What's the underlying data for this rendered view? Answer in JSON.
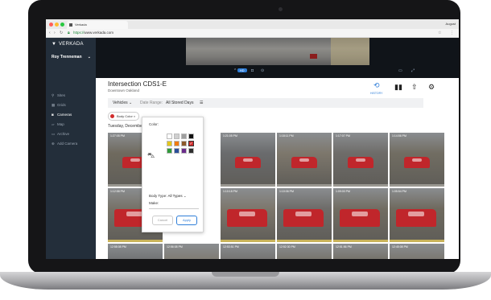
{
  "browser": {
    "tab_title": "Verkada",
    "profile": "August",
    "url_protocol": "https://",
    "url_rest": "www.verkada.com",
    "back_icon": "back-arrow-icon",
    "forward_icon": "forward-arrow-icon",
    "reload_icon": "reload-icon",
    "lock_icon": "lock-icon",
    "star_icon": "star-icon",
    "menu_icon": "more-vertical-icon"
  },
  "sidebar": {
    "logo": "VERKADA",
    "user": "Roy Trenneman",
    "items": [
      {
        "label": "Sites",
        "icon": "pin-icon"
      },
      {
        "label": "Grids",
        "icon": "grid-icon"
      },
      {
        "label": "Cameras",
        "icon": "camera-icon"
      },
      {
        "label": "Map",
        "icon": "map-icon"
      },
      {
        "label": "Archive",
        "icon": "archive-icon"
      },
      {
        "label": "Add Camera",
        "icon": "plus-circle-icon"
      }
    ]
  },
  "video_controls": {
    "quality": "HD"
  },
  "header": {
    "title": "Intersection CDS1-E",
    "subtitle": "Downtown Oakland",
    "history_label": "HISTORY"
  },
  "filterbar": {
    "vehicles_label": "Vehicles",
    "date_range_label": "Date Range:",
    "date_range_value": "All Stored Days"
  },
  "chip": {
    "label": "Body Color"
  },
  "date_label": "Tuesday, December 5",
  "popover": {
    "color_label": "Color:",
    "body_type_label": "Body Type:",
    "body_type_value": "All Types",
    "make_label": "Make:",
    "cancel": "Cancel",
    "apply": "Apply",
    "swatches": [
      "#ffffff",
      "#cfcfcf",
      "#9e9e9e",
      "#111111",
      "#e3c61c",
      "#f07b12",
      "#8b5a2b",
      "#d12d2d",
      "#2f9a3a",
      "#2a4f9a",
      "#6b2b8b",
      "#2e2e2e"
    ]
  },
  "tiles": [
    {
      "time": "1:27:05 PM"
    },
    {
      "time": "1:16:27 PM"
    },
    {
      "time": "1:21:05 PM"
    },
    {
      "time": "1:18:11 PM"
    },
    {
      "time": "1:17:07 PM"
    },
    {
      "time": "1:14:56 PM"
    },
    {
      "time": "1:12:58 PM"
    },
    {
      "time": "1:15:15 PM"
    },
    {
      "time": "1:10:18 PM"
    },
    {
      "time": "1:10:06 PM"
    },
    {
      "time": "1:09:00 PM"
    },
    {
      "time": "1:05:54 PM"
    },
    {
      "time": "12:58:08 PM"
    },
    {
      "time": "12:56:08 PM"
    },
    {
      "time": "12:53:51 PM"
    },
    {
      "time": "12:52:30 PM"
    },
    {
      "time": "12:51:56 PM"
    },
    {
      "time": "12:45:08 PM"
    }
  ]
}
